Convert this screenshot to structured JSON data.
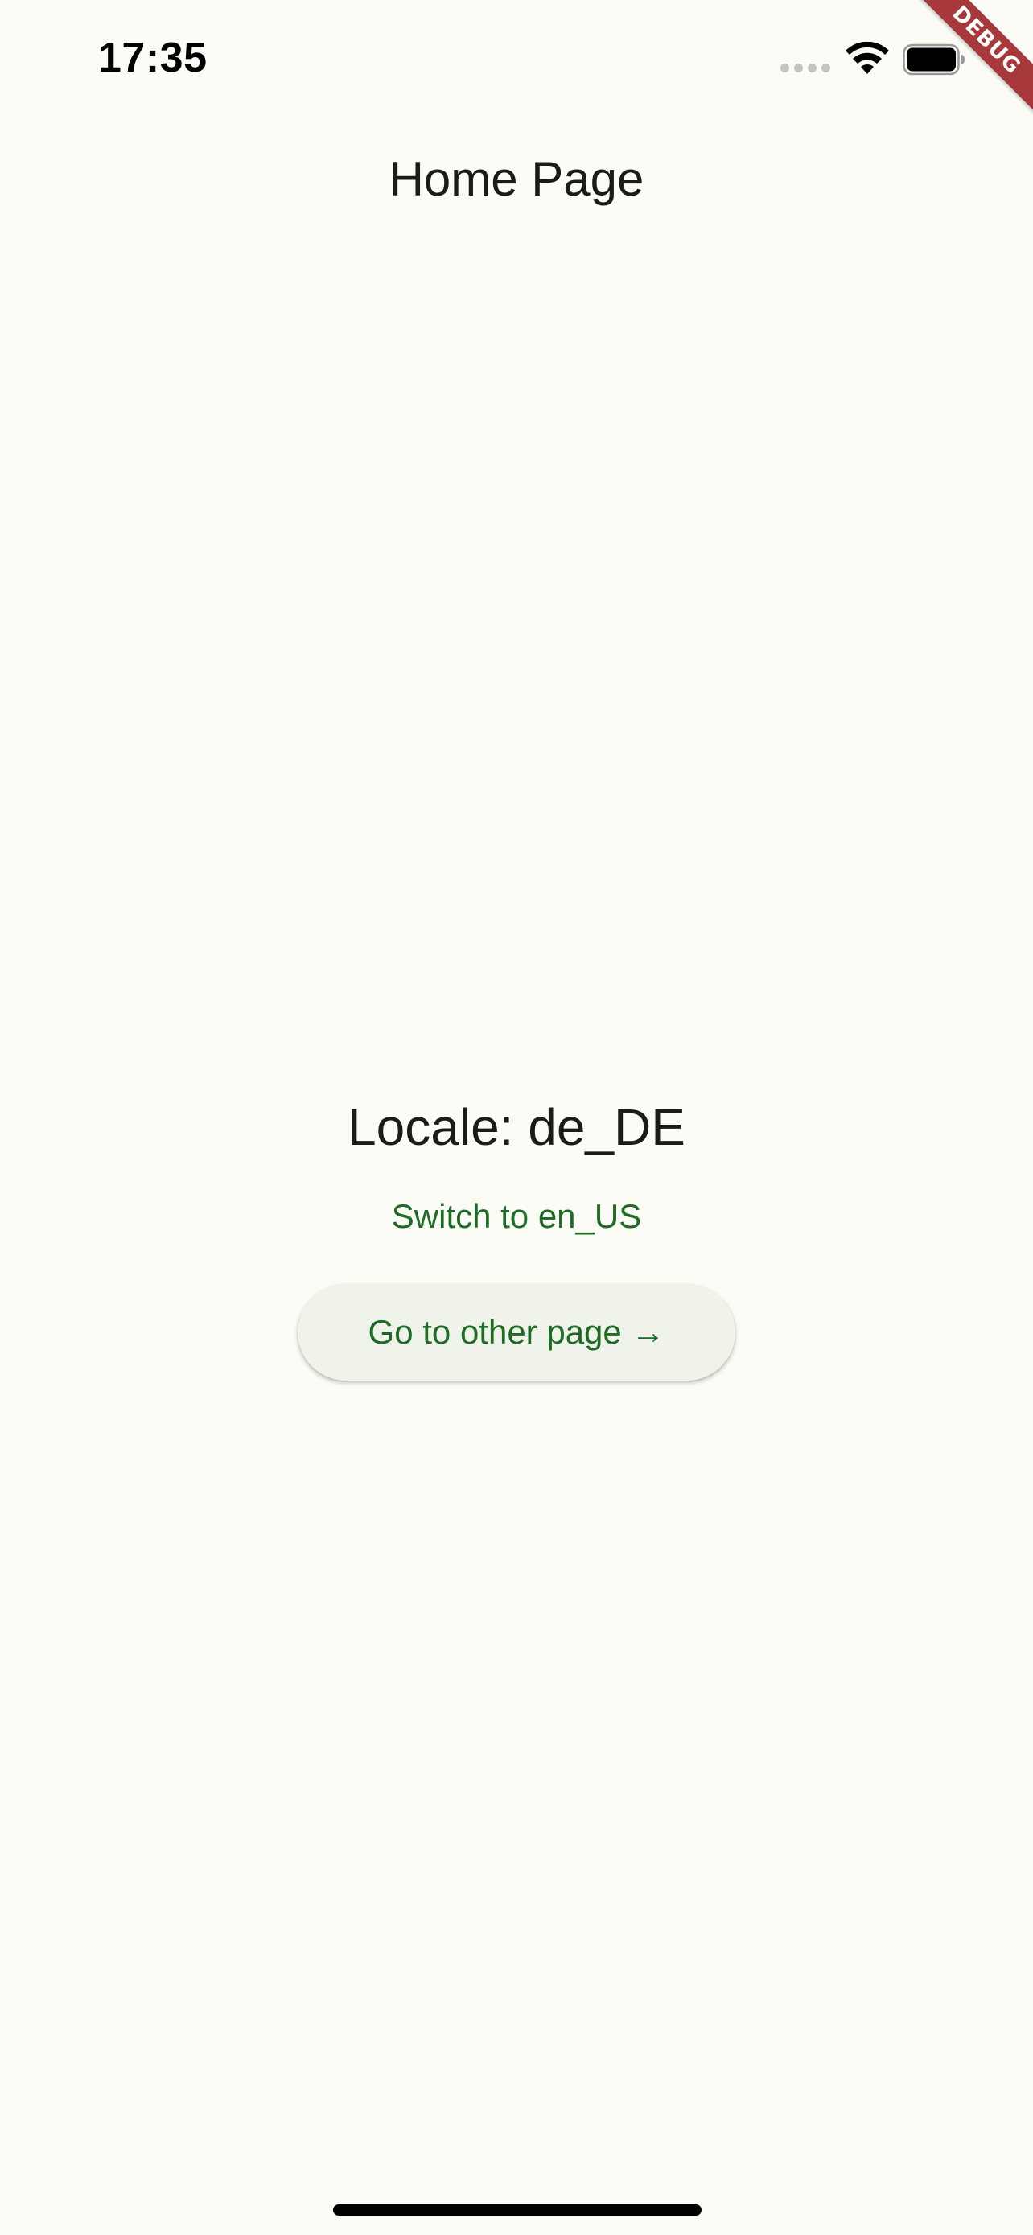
{
  "status_bar": {
    "time": "17:35",
    "icons": [
      "signal-dots-icon",
      "wifi-icon",
      "battery-icon"
    ]
  },
  "debug_banner": {
    "label": "DEBUG",
    "color": "#a6383b"
  },
  "app_bar": {
    "title": "Home Page"
  },
  "main": {
    "locale_label": "Locale: de_DE",
    "switch_button_label": "Switch to en_US",
    "nav_button_label": "Go to other page →"
  },
  "colors": {
    "background": "#fcfcf7",
    "accent": "#1d6b24",
    "button_surface": "#f0f3ea",
    "text": "#1b1c18"
  }
}
